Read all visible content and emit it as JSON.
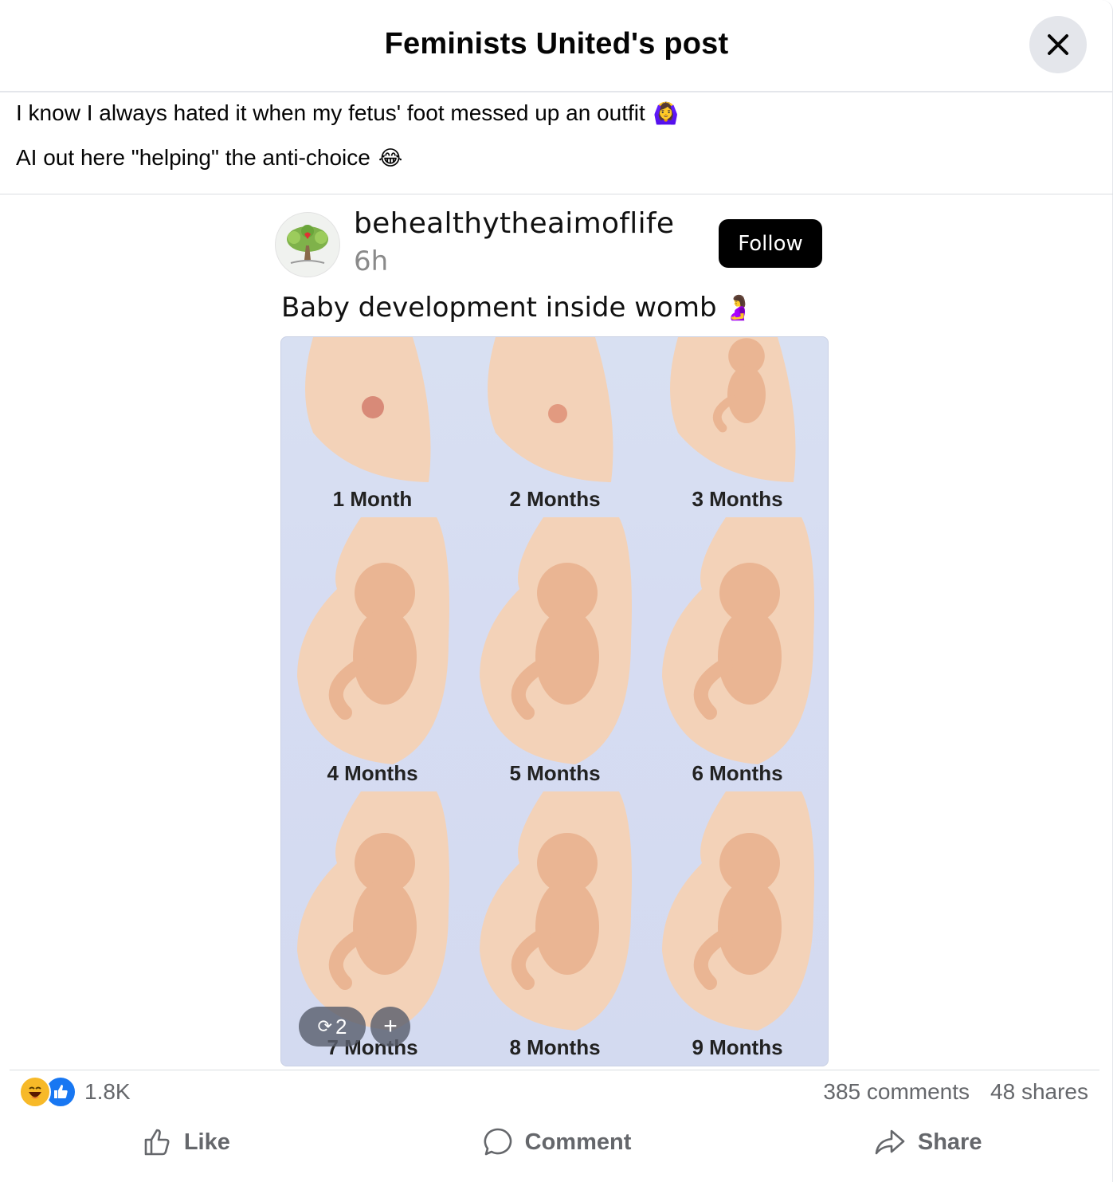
{
  "header": {
    "title": "Feminists United's post"
  },
  "caption": {
    "line1": "I know I always hated it when my fetus' foot messed up an outfit",
    "line1_emoji": "🙆‍♀️",
    "line2": "AI out here \"helping\" the anti-choice",
    "line2_emoji": "😂"
  },
  "embed": {
    "handle": "behealthytheaimoflife",
    "age": "6h",
    "follow_label": "Follow",
    "caption": "Baby development inside womb",
    "caption_emoji": "🤰",
    "months": [
      "1 Month",
      "2 Months",
      "3 Months",
      "4 Months",
      "5 Months",
      "6 Months",
      "7 Months",
      "8 Months",
      "9 Months"
    ],
    "repost_count": "2",
    "plus_label": "+"
  },
  "stats": {
    "reaction_count": "1.8K",
    "comments": "385 comments",
    "shares": "48 shares"
  },
  "actions": {
    "like": "Like",
    "comment": "Comment",
    "share": "Share"
  },
  "colors": {
    "brand_blue": "#1877f2",
    "haha_yellow": "#f7b928",
    "muted_text": "#65676b",
    "image_bg": "#d6dcf2",
    "skin": "#eab593"
  }
}
